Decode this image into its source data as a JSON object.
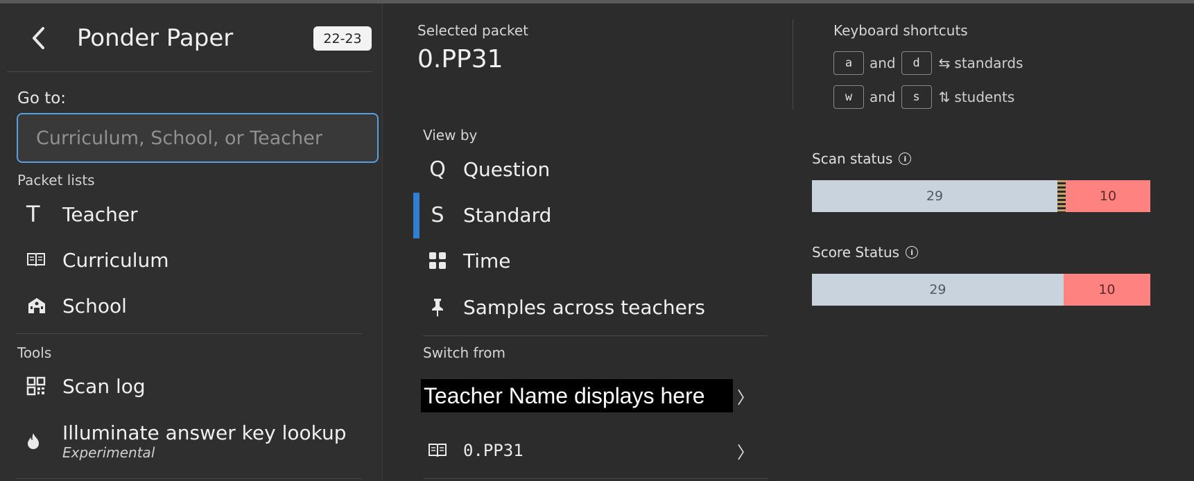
{
  "nav": {
    "title": "Ponder Paper",
    "year_badge": "22-23",
    "goto_label": "Go to:",
    "search_placeholder": "Curriculum, School, or Teacher",
    "packet_lists_label": "Packet lists",
    "packet_lists": [
      {
        "label": "Teacher",
        "icon": "teacher-t-icon"
      },
      {
        "label": "Curriculum",
        "icon": "book-icon"
      },
      {
        "label": "School",
        "icon": "school-icon"
      }
    ],
    "tools_label": "Tools",
    "tools": [
      {
        "label": "Scan log",
        "icon": "qr-code-icon"
      },
      {
        "label": "Illuminate answer key lookup",
        "sublabel": "Experimental",
        "icon": "fire-icon"
      }
    ]
  },
  "packet": {
    "selected_label": "Selected packet",
    "id": "0.PP31"
  },
  "view_by": {
    "label": "View by",
    "items": [
      {
        "label": "Question",
        "icon_glyph": "Q",
        "active": false
      },
      {
        "label": "Standard",
        "icon_glyph": "S",
        "active": true
      },
      {
        "label": "Time",
        "icon": "grid-icon",
        "active": false
      },
      {
        "label": "Samples across teachers",
        "icon": "pin-icon",
        "active": false
      }
    ],
    "accent_color": "#2f7fd0"
  },
  "switch_from": {
    "label": "Switch from",
    "teacher_overlay": "Teacher Name displays here",
    "packet_id": "0.PP31"
  },
  "shortcuts": {
    "label": "Keyboard shortcuts",
    "rows": [
      {
        "key1": "a",
        "and": "and",
        "key2": "d",
        "arrow": "⇆",
        "target": "standards"
      },
      {
        "key1": "w",
        "and": "and",
        "key2": "s",
        "arrow": "⇅",
        "target": "students"
      }
    ]
  },
  "scan_status": {
    "label": "Scan status",
    "done": 29,
    "pending": 10,
    "colors": {
      "done": "#c8d3de",
      "pending": "#fe8380"
    }
  },
  "score_status": {
    "label": "Score Status",
    "done": 29,
    "pending": 10,
    "colors": {
      "done": "#c8d3de",
      "pending": "#fe8380"
    }
  }
}
